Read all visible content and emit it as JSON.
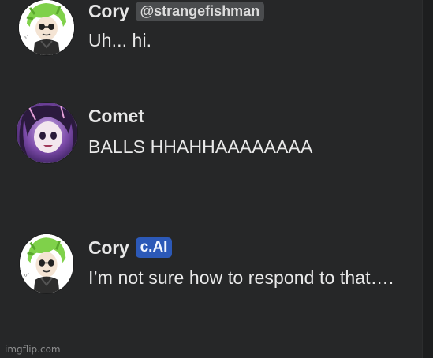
{
  "messages": [
    {
      "author": "Cory",
      "badge": "@strangefishman",
      "badge_type": "handle",
      "text": "Uh... hi.",
      "avatar_icon": "green-haired-character-avatar"
    },
    {
      "author": "Comet",
      "badge": "",
      "text": "BALLS HHAHHAAAAAAAA",
      "avatar_icon": "purple-haired-character-avatar"
    },
    {
      "author": "Cory",
      "badge": "c.AI",
      "badge_type": "ai",
      "text": "I’m not sure how to respond to that….",
      "avatar_icon": "green-haired-character-avatar"
    }
  ],
  "watermark": "imgflip.com",
  "colors": {
    "background": "#262728",
    "text": "#e9e9e9",
    "handle_pill": "#4a4c4e",
    "ai_pill": "#2c59b8"
  }
}
